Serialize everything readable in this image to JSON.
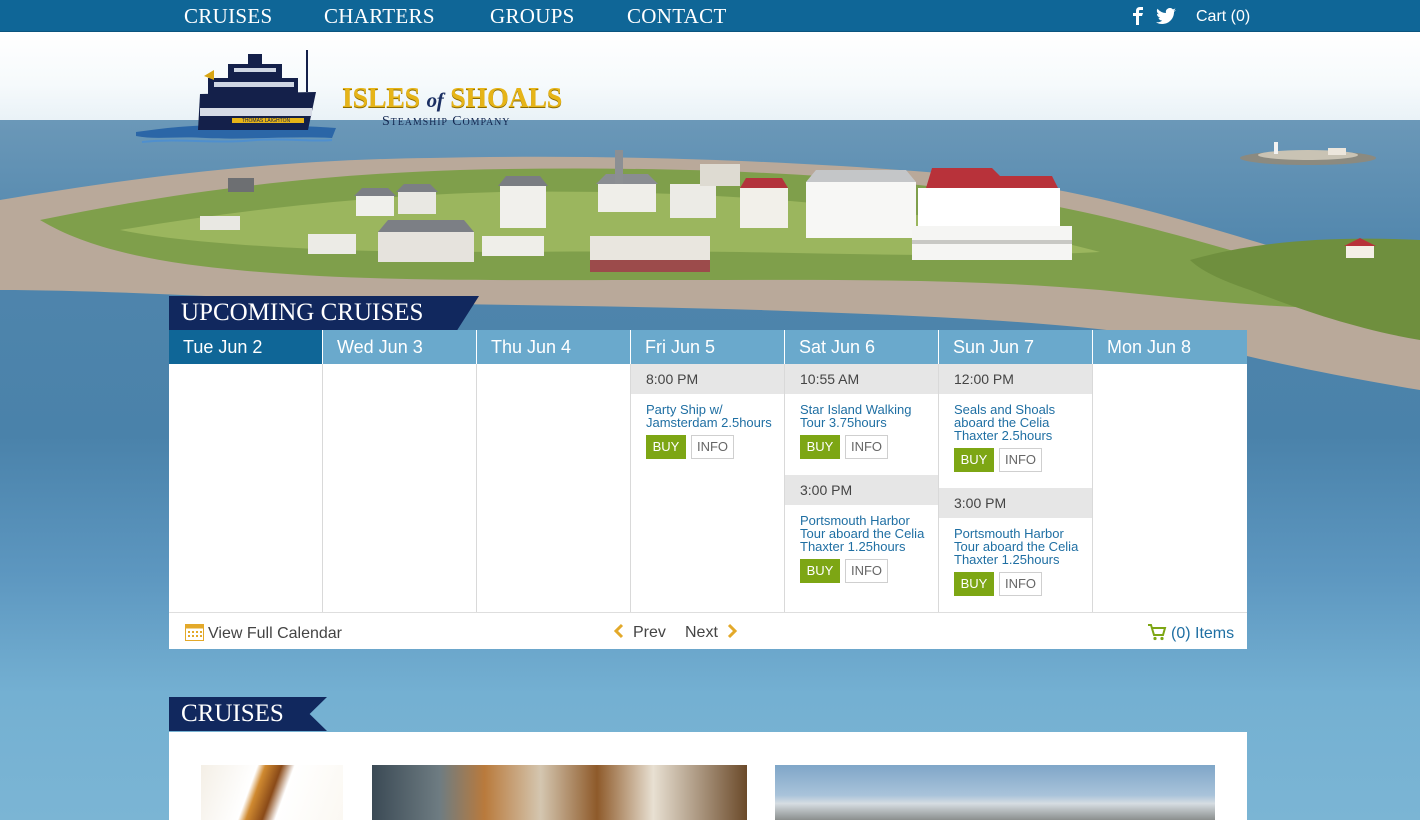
{
  "nav": {
    "items": [
      {
        "label": "CRUISES"
      },
      {
        "label": "CHARTERS"
      },
      {
        "label": "GROUPS"
      },
      {
        "label": "CONTACT"
      }
    ],
    "social": [
      {
        "icon": "facebook-icon"
      },
      {
        "icon": "twitter-icon"
      }
    ],
    "cart_label": "Cart (0)"
  },
  "brand": {
    "word_isles": "ISLES",
    "word_of": "of",
    "word_shoals": "SHOALS",
    "subtitle": "Steamship Company",
    "boat_name": "THOMAS LAIGHTON"
  },
  "upcoming": {
    "title": "UPCOMING CRUISES",
    "days": [
      {
        "label": "Tue Jun 2",
        "active": true,
        "slots": []
      },
      {
        "label": "Wed Jun 3",
        "slots": []
      },
      {
        "label": "Thu Jun 4",
        "slots": []
      },
      {
        "label": "Fri Jun 5",
        "slots": [
          {
            "time": "8:00 PM",
            "title_lines": [
              "Party Ship w/",
              "Jamsterdam 2.5hours"
            ]
          }
        ]
      },
      {
        "label": "Sat Jun 6",
        "slots": [
          {
            "time": "10:55 AM",
            "title_lines": [
              "Star Island Walking",
              "Tour 3.75hours"
            ]
          },
          {
            "time": "3:00 PM",
            "title_lines": [
              "Portsmouth Harbor",
              "Tour aboard the Celia",
              "Thaxter 1.25hours"
            ]
          }
        ]
      },
      {
        "label": "Sun Jun 7",
        "slots": [
          {
            "time": "12:00 PM",
            "title_lines": [
              "Seals and Shoals",
              "aboard the Celia",
              "Thaxter 2.5hours"
            ]
          },
          {
            "time": "3:00 PM",
            "title_lines": [
              "Portsmouth Harbor",
              "Tour aboard the Celia",
              "Thaxter 1.25hours"
            ]
          }
        ]
      },
      {
        "label": "Mon Jun 8",
        "slots": []
      }
    ],
    "buy_label": "BUY",
    "info_label": "INFO",
    "footer": {
      "calendar_label": "View Full Calendar",
      "prev_label": "Prev",
      "next_label": "Next",
      "items_label": "(0) Items"
    }
  },
  "cruises_section": {
    "title": "CRUISES"
  },
  "colors": {
    "nav_bg": "#0f6697",
    "header_bg": "#6aa9cc",
    "active_day": "#0f6697",
    "tag_bg": "#11285e",
    "buy": "#7da614",
    "link": "#1f6fa3",
    "logo_gold": "#e6b418"
  }
}
